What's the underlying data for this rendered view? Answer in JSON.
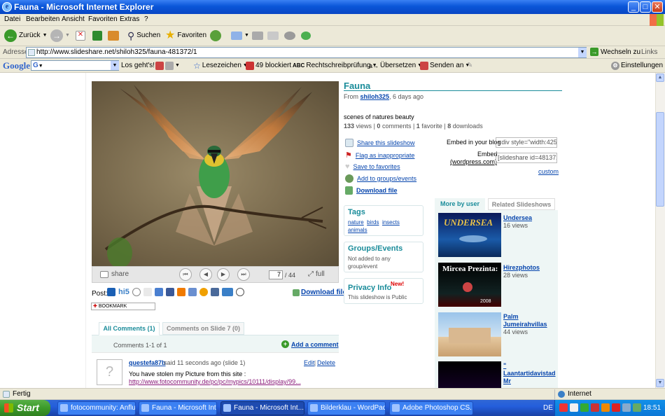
{
  "window": {
    "title": "Fauna - Microsoft Internet Explorer"
  },
  "menu": [
    "Datei",
    "Bearbeiten",
    "Ansicht",
    "Favoriten",
    "Extras",
    "?"
  ],
  "toolbar": {
    "back": "Zurück",
    "search": "Suchen",
    "favorites": "Favoriten"
  },
  "address": {
    "label": "Adresse",
    "url": "http://www.slideshare.net/shiloh325/fauna-481372/1",
    "go": "Wechseln zu",
    "links": "Links"
  },
  "google": {
    "logo": "Google",
    "los": "Los geht's!",
    "bookmarks": "Lesezeichen",
    "blocked": "49 blockiert",
    "spell": "Rechtschreibprüfung",
    "translate": "Übersetzen",
    "send": "Senden an",
    "settings": "Einstellungen"
  },
  "page": {
    "title": "Fauna",
    "from_label": "From",
    "author": "shiloh325",
    "time": ", 6 days ago",
    "description": "scenes of natures beauty",
    "stats": {
      "views": "133",
      "views_label": "views",
      "comments": "0",
      "comments_label": "comments",
      "favorite": "1",
      "favorite_label": "favorite",
      "downloads": "8",
      "downloads_label": "downloads"
    },
    "actions": [
      "Share this slideshow",
      "Flag as inappropriate",
      "Save to favorites",
      "Add to groups/events",
      "Download file"
    ],
    "embed_label": "Embed in your blog",
    "embed_value": "<div style=\"width:425px",
    "embed2_label": "Embed",
    "embed2_sub": "(wordpress.com)",
    "embed2_value": "[slideshare id=481372&",
    "custom": "custom",
    "tags_title": "Tags",
    "tags": [
      "nature",
      "birds",
      "insects",
      "animals"
    ],
    "groups_title": "Groups/Events",
    "groups_text": "Not added to any group/event",
    "privacy_title": "Privacy Info",
    "privacy_new": "New!",
    "privacy_text": "This slideshow is Public",
    "player": {
      "share": "share",
      "current": "7",
      "total": "/ 44",
      "full": "full"
    },
    "post_label": "Post:",
    "download_file": "Download file",
    "bookmark": "BOOKMARK",
    "tabs": {
      "all": "All Comments (1)",
      "slide": "Comments on Slide 7 (0)"
    },
    "comments_range": "Comments 1-1 of 1",
    "add_comment": "Add a comment",
    "comment": {
      "user": "questefa87b",
      "said": " said 11 seconds ago (slide 1)",
      "edit": "Edit",
      "delete": "Delete",
      "text": "You have stolen my Picture from this site :",
      "link": "http://www.fotocommunity.de/pc/pc/mypics/10111/display/99..."
    },
    "right_tabs": {
      "more": "More by user",
      "related": "Related Slideshows"
    },
    "related": [
      {
        "title": "Undersea",
        "views": "16 views",
        "thumb_text": "UNDERSEA"
      },
      {
        "title": "Hirezphotos",
        "views": "28 views",
        "thumb_text": "Mircea Prezinta:",
        "thumb_sub": "2008"
      },
      {
        "title": "Palm Jumeirahvillas",
        "views": "44 views"
      },
      {
        "title": "\" Laantartidavistad Mr",
        "views": ""
      }
    ],
    "views_suffix": "views"
  },
  "status": {
    "text": "Fertig",
    "zone": "Internet"
  },
  "taskbar": {
    "start": "Start",
    "tasks": [
      "fotocommunity: Anflu...",
      "Fauna - Microsoft Int...",
      "Fauna - Microsoft Int...",
      "Bilderklau - WordPad",
      "Adobe Photoshop CS..."
    ],
    "lang": "DE",
    "clock": "18:51"
  }
}
